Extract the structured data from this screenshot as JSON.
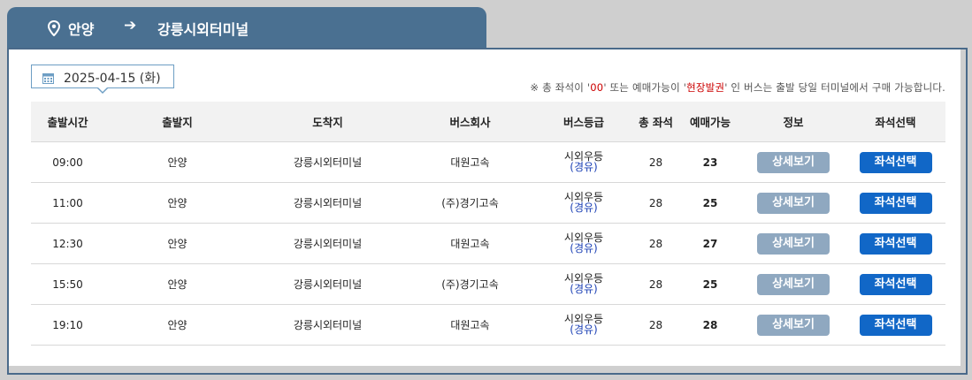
{
  "route": {
    "origin": "안양",
    "arrow": "➔",
    "destination": "강릉시외터미널"
  },
  "date": "2025-04-15 (화)",
  "notice": {
    "prefix": "※ 총 좌석이 '",
    "zero": "00",
    "mid": "' 또는 예매가능이 '",
    "onsite": "현장발권",
    "suffix": "' 인 버스는 출발 당일 터미널에서 구매 가능합니다."
  },
  "table": {
    "headers": [
      "출발시간",
      "출발지",
      "도착지",
      "버스회사",
      "버스등급",
      "총 좌석",
      "예매가능",
      "정보",
      "좌석선택"
    ],
    "rows": [
      {
        "time": "09:00",
        "from": "안양",
        "to": "강릉시외터미널",
        "company": "대원고속",
        "grade": "시외우등",
        "grade_sub": "(경유)",
        "total": "28",
        "available": "23",
        "detail": "상세보기",
        "select": "좌석선택"
      },
      {
        "time": "11:00",
        "from": "안양",
        "to": "강릉시외터미널",
        "company": "(주)경기고속",
        "grade": "시외우등",
        "grade_sub": "(경유)",
        "total": "28",
        "available": "25",
        "detail": "상세보기",
        "select": "좌석선택"
      },
      {
        "time": "12:30",
        "from": "안양",
        "to": "강릉시외터미널",
        "company": "대원고속",
        "grade": "시외우등",
        "grade_sub": "(경유)",
        "total": "28",
        "available": "27",
        "detail": "상세보기",
        "select": "좌석선택"
      },
      {
        "time": "15:50",
        "from": "안양",
        "to": "강릉시외터미널",
        "company": "(주)경기고속",
        "grade": "시외우등",
        "grade_sub": "(경유)",
        "total": "28",
        "available": "25",
        "detail": "상세보기",
        "select": "좌석선택"
      },
      {
        "time": "19:10",
        "from": "안양",
        "to": "강릉시외터미널",
        "company": "대원고속",
        "grade": "시외우등",
        "grade_sub": "(경유)",
        "total": "28",
        "available": "28",
        "detail": "상세보기",
        "select": "좌석선택"
      }
    ]
  },
  "colors": {
    "tab": "#4a7091",
    "detail_button": "#8fa8c0",
    "select_button": "#1167c7",
    "notice_highlight": "#cc0000",
    "grade_sub": "#1a3fb4"
  },
  "icons": {
    "pin": "location-pin-icon",
    "arrow": "arrow-right-icon",
    "calendar": "calendar-icon"
  }
}
